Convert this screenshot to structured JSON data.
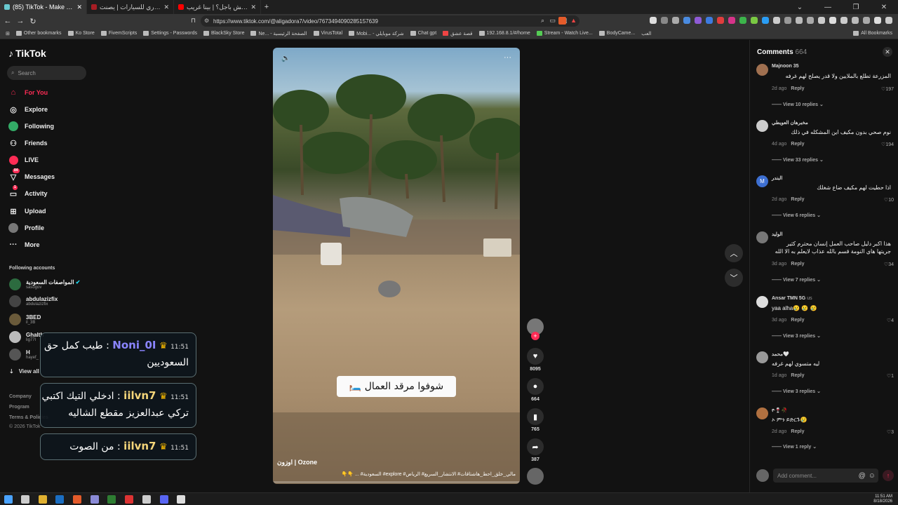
{
  "browser": {
    "tabs": [
      {
        "label": "(85) TikTok - Make Your Day",
        "active": true,
        "color": "#69c9d0"
      },
      {
        "label": "عازل حراري للسيارات | يصنت ‌‌ shield",
        "active": false,
        "color": "#a61d24"
      },
      {
        "label": "سين مش باجل؟ | بينا غريب - ‌be",
        "active": false,
        "color": "#ff0000"
      }
    ],
    "new_tab": "+",
    "url": "https://www.tiktok.com/@aligadora7/video/7673494090285157639",
    "bookmarks": [
      "Other bookmarks",
      "Ko Store",
      "FivemScripts",
      "Settings - Passwords",
      "BlackSky Store",
      "Ne... - الصفحة الرئيسية",
      "VirusTotal",
      "Mobi... - شركة موبايلي",
      "Chat gpt",
      "قصة عشق",
      "192.168.8.1/#/home",
      "Stream - Watch Live...",
      "BodyCame...",
      "العب"
    ],
    "all_bookmarks": "All Bookmarks"
  },
  "sidebar": {
    "logo": "TikTok",
    "search_placeholder": "Search",
    "nav": [
      {
        "label": "For You",
        "icon": "home-icon",
        "active": true
      },
      {
        "label": "Explore",
        "icon": "compass-icon"
      },
      {
        "label": "Following",
        "icon": "following-icon"
      },
      {
        "label": "Friends",
        "icon": "friends-icon"
      },
      {
        "label": "LIVE",
        "icon": "live-icon"
      },
      {
        "label": "Messages",
        "icon": "messages-icon",
        "badge": "84"
      },
      {
        "label": "Activity",
        "icon": "activity-icon",
        "badge": "1"
      },
      {
        "label": "Upload",
        "icon": "upload-icon"
      },
      {
        "label": "Profile",
        "icon": "profile-icon"
      },
      {
        "label": "More",
        "icon": "more-icon"
      }
    ],
    "following_title": "Following accounts",
    "accounts": [
      {
        "name": "المواصفات السعودية",
        "handle": "sasogov",
        "verified": true
      },
      {
        "name": "abdulazizfix",
        "handle": "abdulazizfix"
      },
      {
        "name": "3BED",
        "handle": "il_3B"
      },
      {
        "name": "Ghalth",
        "handle": "lig77l"
      },
      {
        "name": "H",
        "handle": "hayef_"
      }
    ],
    "view_all": "View all",
    "footer": [
      "Company",
      "Program",
      "Terms & Policies",
      "© 2026 TikTok"
    ]
  },
  "chat_overlay": [
    {
      "time": "11:51",
      "user": "Noni_0I",
      "line1": "طيب كمل حق",
      "line2": "السعوديين"
    },
    {
      "time": "11:51",
      "user": "iilvn7",
      "line1": "ادخلي التيك اكتبي",
      "line2": "تركي عبدالعزيز مقطع الشاليه"
    },
    {
      "time": "11:51",
      "user": "iilvn7",
      "line1": "من الصوت",
      "line2": ""
    }
  ],
  "video": {
    "caption": "شوفوا مرقد العمال 🛏️",
    "sound_title": "اوزون | Ozone",
    "description": "مالي_خلق_احط_هاشتاقات# الانتشار_السريع# الرياض# explore# السعودية# ... 👇👇"
  },
  "actions": {
    "likes": "8095",
    "comments": "664",
    "saves": "765",
    "shares": "387"
  },
  "comments_panel": {
    "title": "Comments",
    "count": "664",
    "items": [
      {
        "name": "Majnoon 35",
        "text": "المزرعة تطلع بالملايين ولا قدر يصلح لهم غرفه",
        "time": "2d ago",
        "reply": "Reply",
        "likes": "197",
        "view_replies": "View 10 replies"
      },
      {
        "name": "مخبرهان العويطي",
        "text": "نوم صحي بدون مكيف اين المشكله في ذلك",
        "time": "4d ago",
        "reply": "Reply",
        "likes": "194",
        "view_replies": "View 33 replies"
      },
      {
        "name": "البندر",
        "text": "اذا حطيت لهم مكيف ضاع شغلك",
        "time": "2d ago",
        "reply": "Reply",
        "likes": "10",
        "view_replies": "View 6 replies",
        "initial": "M"
      },
      {
        "name": "الوليد",
        "text": "هذا اكبر دليل صاحب العمل إنسان محترم كثير جريتها هاي النومة قسم بالله عذاب لايعلم به الا الله",
        "time": "3d ago",
        "reply": "Reply",
        "likes": "34",
        "view_replies": "View 7 replies"
      },
      {
        "name": "Ansar TMN 5G",
        "badge": "us",
        "text": "yaa alha😢 😢 😢",
        "time": "3d ago",
        "reply": "Reply",
        "likes": "4",
        "view_replies": "View 3 replies"
      },
      {
        "name": "محمد🤍",
        "text": "ليه متسوي لهم غرفه",
        "time": "1d ago",
        "reply": "Reply",
        "likes": "1",
        "view_replies": "View 3 replies"
      },
      {
        "name": "ዮ🍷🥀",
        "text": "ኦ ምን ይድርጉ😢",
        "time": "2d ago",
        "reply": "Reply",
        "likes": "3",
        "view_replies": "View 1 reply"
      }
    ],
    "input_placeholder": "Add comment..."
  },
  "taskbar": {
    "time": "11:51 AM",
    "date": "8/18/2026"
  }
}
